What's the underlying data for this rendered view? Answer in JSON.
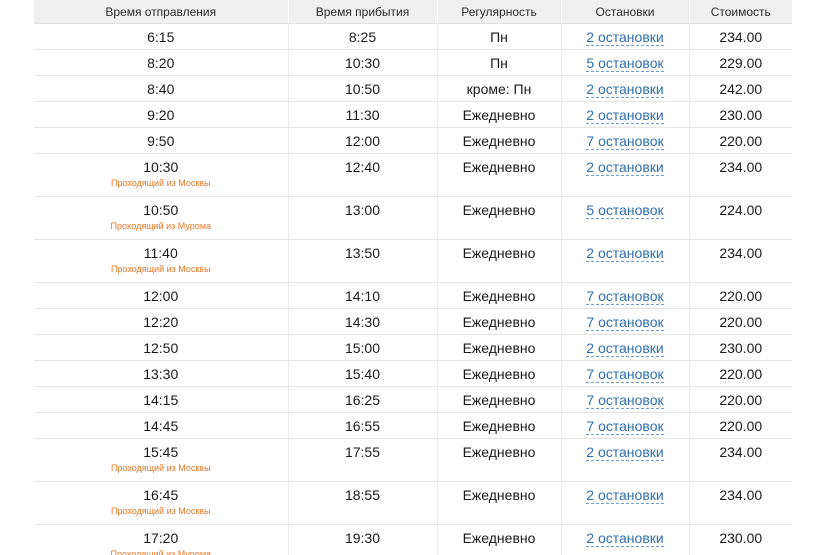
{
  "table": {
    "headers": {
      "departure": "Время отправления",
      "arrival": "Время прибытия",
      "regularity": "Регулярность",
      "stops": "Остановки",
      "price": "Стоимость"
    },
    "rows": [
      {
        "departure": "6:15",
        "note": "",
        "arrival": "8:25",
        "regularity": "Пн",
        "stops": "2 остановки",
        "price": "234.00"
      },
      {
        "departure": "8:20",
        "note": "",
        "arrival": "10:30",
        "regularity": "Пн",
        "stops": "5 остановок",
        "price": "229.00"
      },
      {
        "departure": "8:40",
        "note": "",
        "arrival": "10:50",
        "regularity": "кроме: Пн",
        "stops": "2 остановки",
        "price": "242.00"
      },
      {
        "departure": "9:20",
        "note": "",
        "arrival": "11:30",
        "regularity": "Ежедневно",
        "stops": "2 остановки",
        "price": "230.00"
      },
      {
        "departure": "9:50",
        "note": "",
        "arrival": "12:00",
        "regularity": "Ежедневно",
        "stops": "7 остановок",
        "price": "220.00"
      },
      {
        "departure": "10:30",
        "note": "Проходящий из Москвы",
        "arrival": "12:40",
        "regularity": "Ежедневно",
        "stops": "2 остановки",
        "price": "234.00"
      },
      {
        "departure": "10:50",
        "note": "Проходящий из Мурома",
        "arrival": "13:00",
        "regularity": "Ежедневно",
        "stops": "5 остановок",
        "price": "224.00"
      },
      {
        "departure": "11:40",
        "note": "Проходящий из Москвы",
        "arrival": "13:50",
        "regularity": "Ежедневно",
        "stops": "2 остановки",
        "price": "234.00"
      },
      {
        "departure": "12:00",
        "note": "",
        "arrival": "14:10",
        "regularity": "Ежедневно",
        "stops": "7 остановок",
        "price": "220.00"
      },
      {
        "departure": "12:20",
        "note": "",
        "arrival": "14:30",
        "regularity": "Ежедневно",
        "stops": "7 остановок",
        "price": "220.00"
      },
      {
        "departure": "12:50",
        "note": "",
        "arrival": "15:00",
        "regularity": "Ежедневно",
        "stops": "2 остановки",
        "price": "230.00"
      },
      {
        "departure": "13:30",
        "note": "",
        "arrival": "15:40",
        "regularity": "Ежедневно",
        "stops": "7 остановок",
        "price": "220.00"
      },
      {
        "departure": "14:15",
        "note": "",
        "arrival": "16:25",
        "regularity": "Ежедневно",
        "stops": "7 остановок",
        "price": "220.00"
      },
      {
        "departure": "14:45",
        "note": "",
        "arrival": "16:55",
        "regularity": "Ежедневно",
        "stops": "7 остановок",
        "price": "220.00"
      },
      {
        "departure": "15:45",
        "note": "Проходящий из Москвы",
        "arrival": "17:55",
        "regularity": "Ежедневно",
        "stops": "2 остановки",
        "price": "234.00"
      },
      {
        "departure": "16:45",
        "note": "Проходящий из Москвы",
        "arrival": "18:55",
        "regularity": "Ежедневно",
        "stops": "2 остановки",
        "price": "234.00"
      },
      {
        "departure": "17:20",
        "note": "Проходящий из Мурома",
        "arrival": "19:30",
        "regularity": "Ежедневно",
        "stops": "2 остановки",
        "price": "230.00"
      }
    ]
  }
}
